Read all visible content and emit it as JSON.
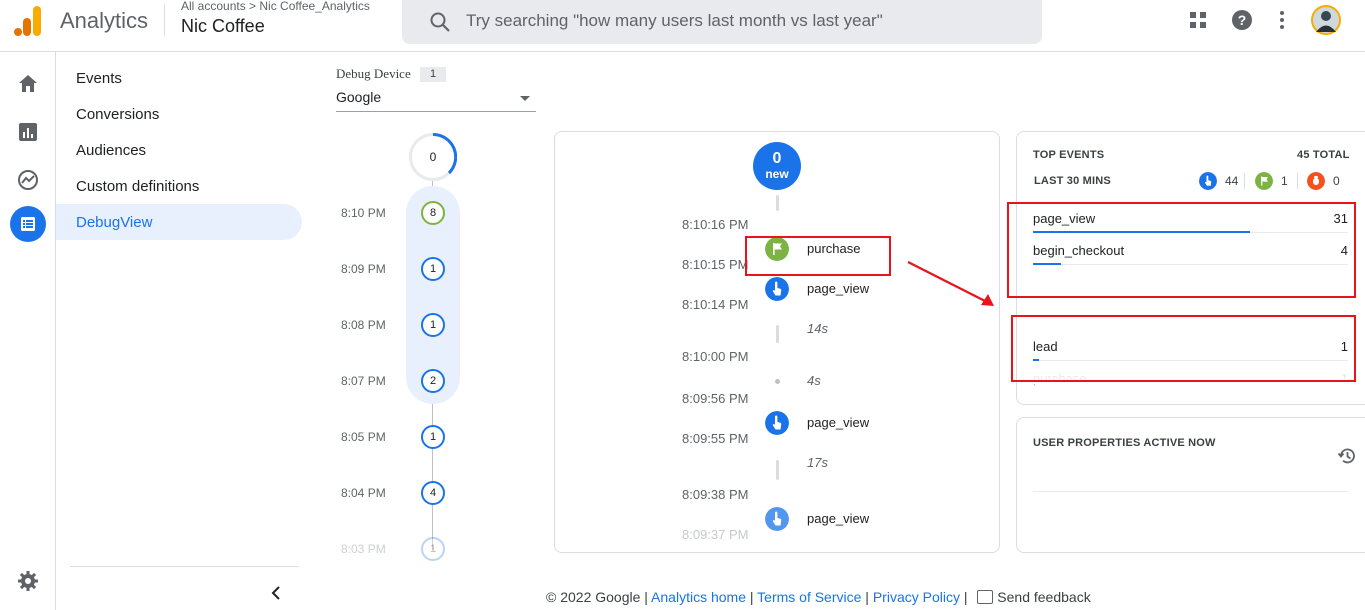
{
  "header": {
    "app_title": "Analytics",
    "breadcrumb": "All accounts > Nic Coffee_Analytics",
    "property_name": "Nic Coffee",
    "search_placeholder": "Try searching \"how many users last month vs last year\""
  },
  "icons": {
    "apps": "apps-grid-icon",
    "help": "help-icon",
    "more": "more-vert-icon",
    "rail": [
      "home-icon",
      "reports-icon",
      "explore-icon",
      "advertising-icon",
      "configure-icon"
    ],
    "settings": "settings-gear-icon"
  },
  "subnav": {
    "items": [
      "Events",
      "Conversions",
      "Audiences",
      "Custom definitions",
      "DebugView"
    ],
    "active_index": 4
  },
  "debug_device": {
    "label": "Debug Device",
    "count": "1",
    "selected": "Google"
  },
  "minutes": {
    "top_count": "0",
    "rows": [
      {
        "time": "8:10 PM",
        "count": "8"
      },
      {
        "time": "8:09 PM",
        "count": "1"
      },
      {
        "time": "8:08 PM",
        "count": "1"
      },
      {
        "time": "8:07 PM",
        "count": "2"
      },
      {
        "time": "8:05 PM",
        "count": "1"
      },
      {
        "time": "8:04 PM",
        "count": "4"
      },
      {
        "time": "8:03 PM",
        "count": "1"
      }
    ]
  },
  "stream": {
    "new_count": "0",
    "new_label": "new",
    "times": [
      "8:10:16 PM",
      "8:10:15 PM",
      "8:10:14 PM",
      "8:10:00 PM",
      "8:09:56 PM",
      "8:09:55 PM",
      "8:09:38 PM",
      "8:09:37 PM"
    ],
    "gaps": [
      "14s",
      "4s",
      "17s"
    ],
    "events": [
      {
        "name": "purchase",
        "type": "conversion"
      },
      {
        "name": "page_view",
        "type": "event"
      },
      {
        "name": "page_view",
        "type": "event"
      },
      {
        "name": "page_view",
        "type": "event"
      }
    ]
  },
  "top_events": {
    "title": "TOP EVENTS",
    "total": "45 TOTAL",
    "period": "LAST 30 MINS",
    "counts": {
      "events": "44",
      "conversions": "1",
      "errors": "0"
    },
    "rows": [
      {
        "name": "page_view",
        "value": "31",
        "share": 0.69
      },
      {
        "name": "begin_checkout",
        "value": "4",
        "share": 0.09
      },
      {
        "name": "lead",
        "value": "1",
        "share": 0.02
      },
      {
        "name": "purchase",
        "value": "1",
        "share": 0.02
      }
    ]
  },
  "user_properties": {
    "title": "USER PROPERTIES ACTIVE NOW"
  },
  "footer": {
    "copyright": "© 2022 Google",
    "links": [
      "Analytics home",
      "Terms of Service",
      "Privacy Policy"
    ],
    "feedback": "Send feedback"
  },
  "colors": {
    "accent": "#1a73e8",
    "conversion": "#7cb342",
    "error": "#f4511e",
    "annotation": "#e8141b",
    "logo_orange": "#f9ab00",
    "logo_dark_orange": "#e37400"
  }
}
